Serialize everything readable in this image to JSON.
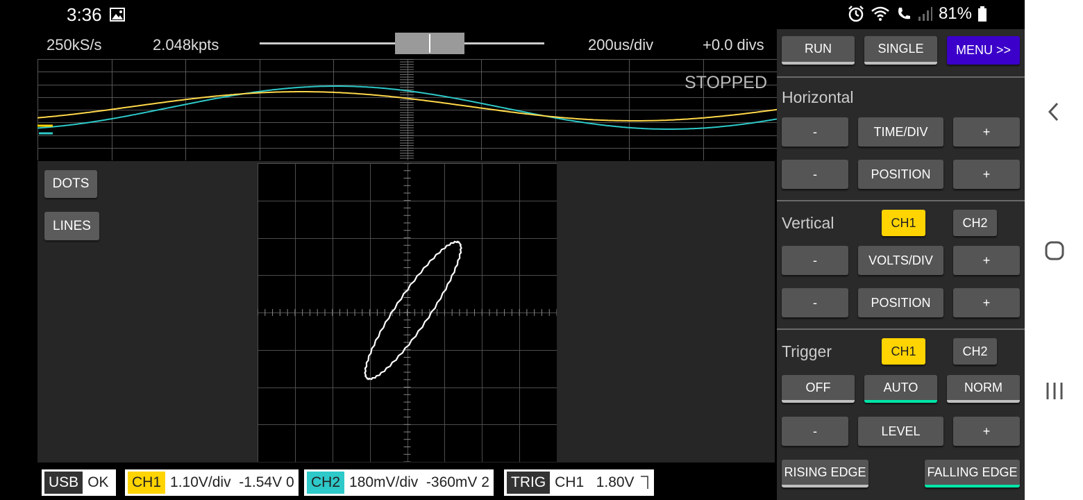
{
  "status": {
    "time": "3:36",
    "battery": "81%",
    "icons": [
      "gallery-icon",
      "alarm-icon",
      "wifi-icon",
      "call-icon",
      "signal-icon",
      "battery-icon"
    ]
  },
  "info_bar": {
    "sample_rate": "250kS/s",
    "points": "2.048kpts",
    "time_div": "200us/div",
    "offset": "+0.0 divs"
  },
  "overview": {
    "state": "STOPPED",
    "colors": {
      "ch1": "#ffd84a",
      "ch2": "#2ec9c9"
    }
  },
  "xy_mode": {
    "dots_label": "DOTS",
    "lines_label": "LINES"
  },
  "bottom": {
    "usb": {
      "tag": "USB",
      "value": "OK"
    },
    "ch1": {
      "tag": "CH1",
      "value": "1.10V/div  -1.54V 0"
    },
    "ch2": {
      "tag": "CH2",
      "value": "180mV/div  -360mV 2"
    },
    "trig": {
      "tag": "TRIG",
      "value": "CH1   1.80V"
    }
  },
  "panel": {
    "run": "RUN",
    "single": "SINGLE",
    "menu": "MENU >>",
    "horizontal": {
      "title": "Horizontal",
      "minus": "-",
      "time_div": "TIME/DIV",
      "plus": "+",
      "position": "POSITION"
    },
    "vertical": {
      "title": "Vertical",
      "ch1": "CH1",
      "ch2": "CH2",
      "minus": "-",
      "volts_div": "VOLTS/DIV",
      "plus": "+",
      "position": "POSITION"
    },
    "trigger": {
      "title": "Trigger",
      "ch1": "CH1",
      "ch2": "CH2",
      "off": "OFF",
      "auto": "AUTO",
      "norm": "NORM",
      "minus": "-",
      "level": "LEVEL",
      "plus": "+",
      "rising": "RISING EDGE",
      "falling": "FALLING EDGE"
    }
  },
  "colors": {
    "ch1": "#ffd400",
    "ch2": "#2ec9c9",
    "menu": "#3b00c9",
    "selected_underline": "#00e5a8"
  }
}
